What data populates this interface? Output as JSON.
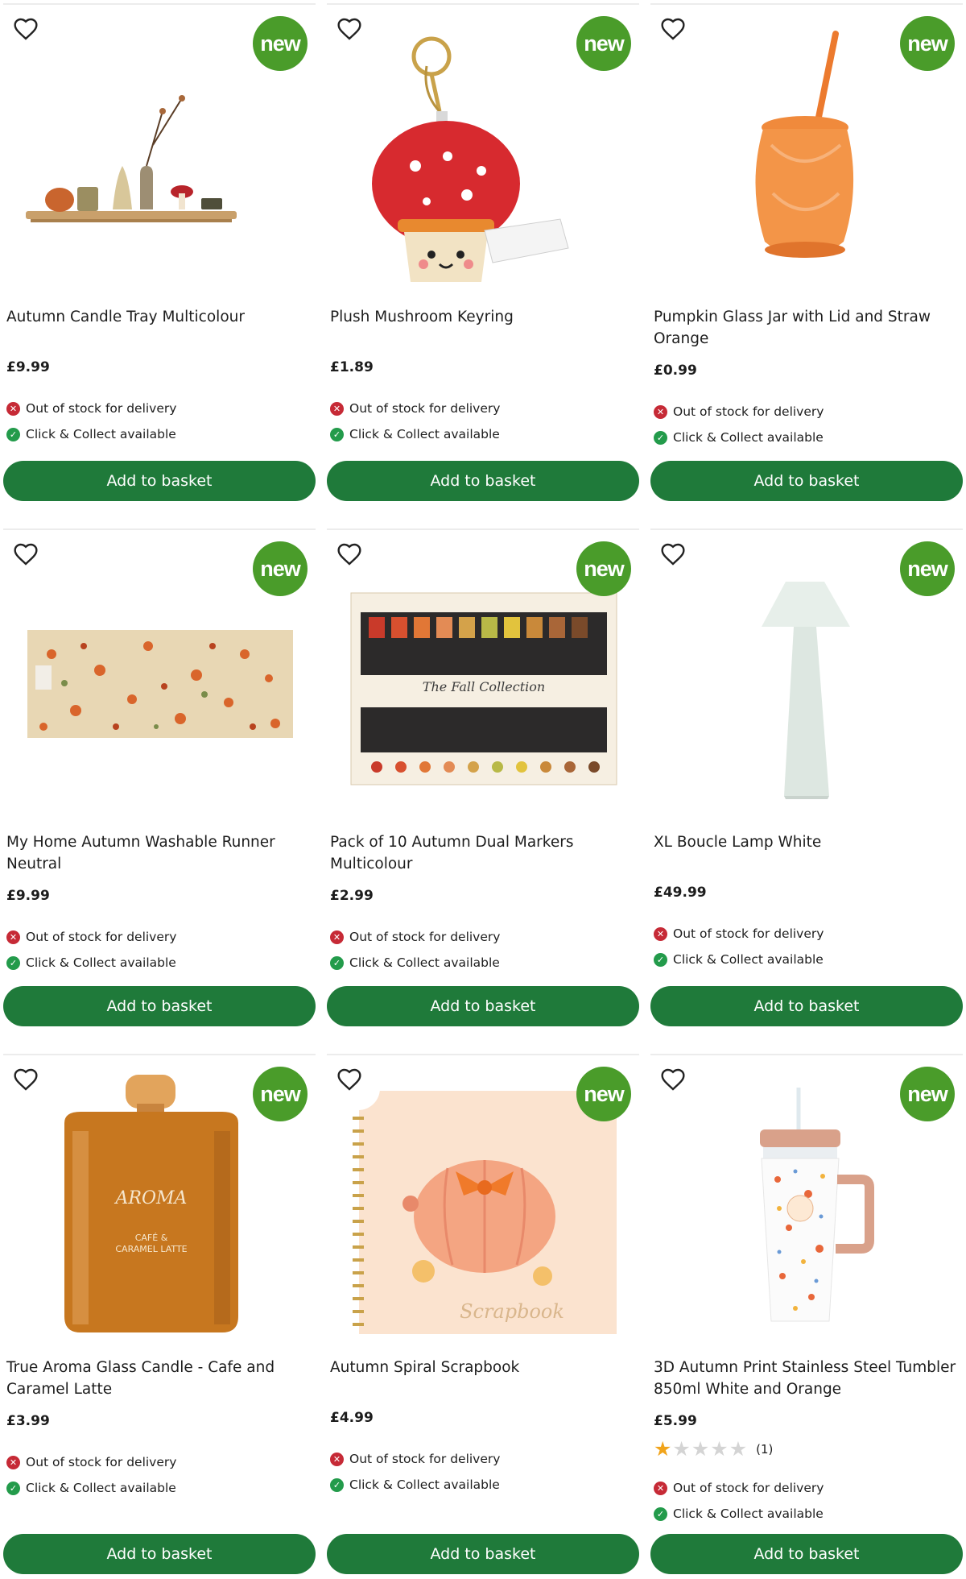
{
  "badge_label": "new",
  "stock": {
    "delivery": "Out of stock for delivery",
    "collect": "Click & Collect available"
  },
  "button_label": "Add to basket",
  "colors": {
    "button": "#1f7a3a",
    "badge": "#4a9c2a",
    "out_of_stock": "#c62a36",
    "available": "#239b4b",
    "star": "#f1a41b"
  },
  "icons": {
    "favourite": "heart-outline-icon",
    "out_of_stock": "cross-circle-icon",
    "available": "check-circle-icon",
    "rating": "star-icon"
  },
  "products": [
    {
      "name": "Autumn Candle Tray Multicolour",
      "price": "£9.99"
    },
    {
      "name": "Plush Mushroom Keyring",
      "price": "£1.89"
    },
    {
      "name": "Pumpkin Glass Jar with Lid and Straw Orange",
      "price": "£0.99"
    },
    {
      "name": "My Home Autumn Washable Runner Neutral",
      "price": "£9.99"
    },
    {
      "name": "Pack of 10 Autumn Dual Markers Multicolour",
      "price": "£2.99"
    },
    {
      "name": "XL Boucle Lamp White",
      "price": "£49.99"
    },
    {
      "name": "True Aroma Glass Candle - Cafe and Caramel Latte",
      "price": "£3.99"
    },
    {
      "name": "Autumn Spiral Scrapbook",
      "price": "£4.99"
    },
    {
      "name": "3D Autumn Print Stainless Steel Tumbler 850ml White and Orange",
      "price": "£5.99",
      "rating": {
        "stars": 1,
        "max": 5,
        "count": "(1)"
      }
    }
  ]
}
